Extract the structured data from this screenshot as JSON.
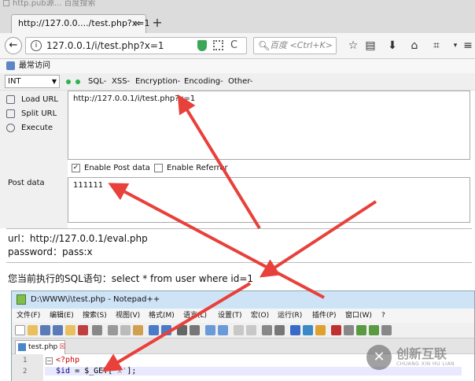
{
  "browser": {
    "background_tab": "http.pub源... 百度搜索",
    "tab_title": "http://127.0.0..../test.php?x=1",
    "tab_close": "×",
    "new_tab": "+",
    "back": "←",
    "url": "127.0.0.1/i/test.php?x=1",
    "reload": "C",
    "search_placeholder": "百度 <Ctrl+K>",
    "toolbar_icons": [
      "star-icon",
      "reading-list-icon",
      "download-icon",
      "home-icon",
      "crop-icon",
      "dropdown-icon",
      "menu-icon"
    ]
  },
  "hackbar": {
    "header_label": "最常访问",
    "select_value": "INT",
    "menus": [
      "SQL-",
      "XSS-",
      "Encryption-",
      "Encoding-",
      "Other-"
    ],
    "side_buttons": [
      "Load URL",
      "Split URL",
      "Execute"
    ],
    "url_value": "http://127.0.0.1/i/test.php?x=1",
    "enable_post": "Enable Post data",
    "enable_referrer": "Enable Referrer",
    "post_checked": true,
    "referrer_checked": false,
    "post_label": "Post data",
    "post_value": "111111"
  },
  "page": {
    "line1": "url：http://127.0.0.1/eval.php",
    "line2": "password：pass:x",
    "line3": "您当前执行的SQL语句：select * from user where id=1"
  },
  "notepad": {
    "title": "D:\\WWW\\i\\test.php - Notepad++",
    "menus": [
      "文件(F)",
      "编辑(E)",
      "搜索(S)",
      "视图(V)",
      "格式(M)",
      "语言(L)",
      "设置(T)",
      "宏(O)",
      "运行(R)",
      "插件(P)",
      "窗口(W)",
      "?"
    ],
    "tab_label": "test.php",
    "line_numbers": [
      "1",
      "2"
    ],
    "code_line1": "<?php",
    "code_line2_var": "$id",
    "code_line2_mid": " = $_GET[",
    "code_line2_str": "'x'",
    "code_line2_end": "];"
  },
  "watermark": {
    "cn": "创新互联",
    "en": "CHUANG XIN HU LIAN"
  },
  "colors": {
    "arrow": "#e8403a",
    "accent": "#2bb24c"
  }
}
